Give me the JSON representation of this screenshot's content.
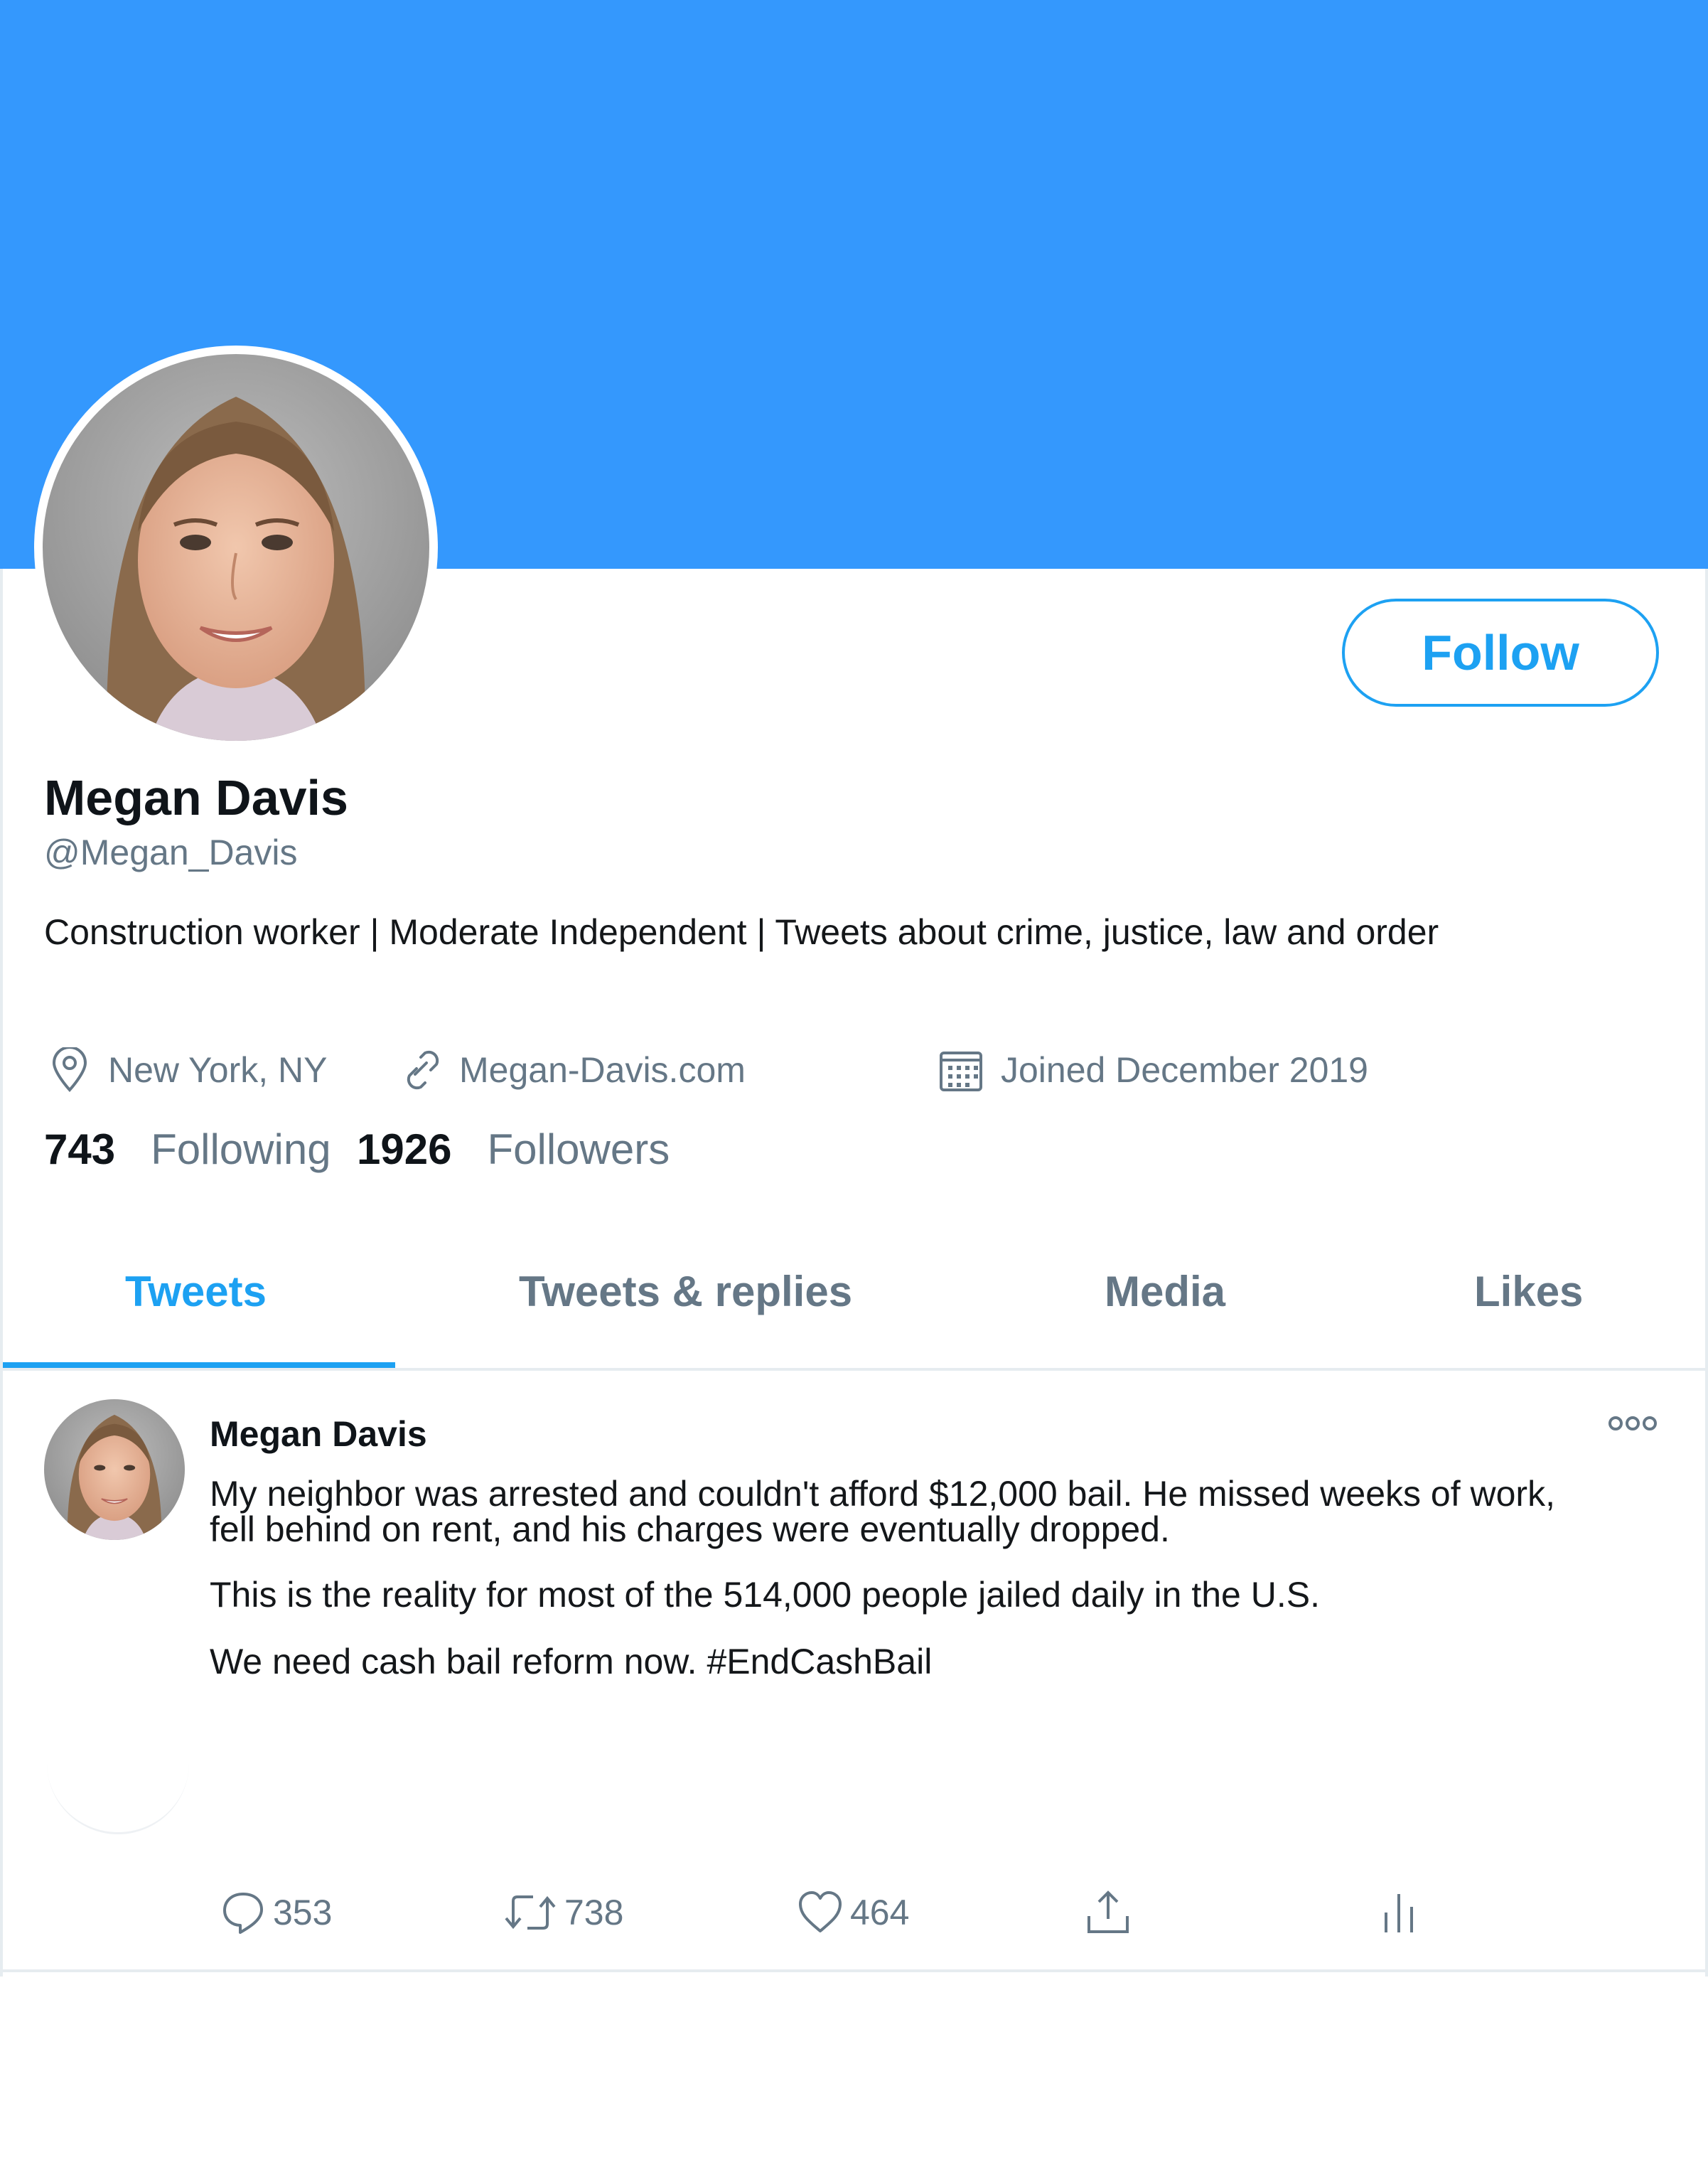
{
  "profile": {
    "name": "Megan Davis",
    "handle": "@Megan_Davis",
    "bio": "Construction worker | Moderate Independent | Tweets about crime, justice, law and order",
    "location": "New York, NY",
    "website": "Megan-Davis.com",
    "joined": "Joined December 2019",
    "following_count": "743",
    "following_label": "Following",
    "followers_count": "1926",
    "followers_label": "Followers",
    "follow_button": "Follow"
  },
  "tabs": [
    {
      "label": "Tweets",
      "active": true
    },
    {
      "label": "Tweets & replies",
      "active": false
    },
    {
      "label": "Media",
      "active": false
    },
    {
      "label": "Likes",
      "active": false
    }
  ],
  "tweet": {
    "author": "Megan Davis",
    "text_line1": "My neighbor was arrested and couldn't afford $12,000 bail. He missed weeks of work,",
    "text_line2": "fell behind on rent, and his charges were eventually dropped.",
    "text_para2": "This is the reality for most of the 514,000 people jailed daily in the U.S.",
    "text_para3": "We need cash bail reform now. #EndCashBail",
    "replies": "353",
    "retweets": "738",
    "likes": "464"
  },
  "icons": {
    "location": "location-pin-icon",
    "link": "link-icon",
    "calendar": "calendar-icon",
    "reply": "reply-icon",
    "retweet": "retweet-icon",
    "like": "heart-icon",
    "share": "share-icon",
    "analytics": "analytics-icon",
    "more": "more-icon"
  },
  "colors": {
    "banner": "#3498fd",
    "accent": "#1da1f2",
    "secondary_text": "#657786",
    "primary_text": "#0f1419"
  }
}
